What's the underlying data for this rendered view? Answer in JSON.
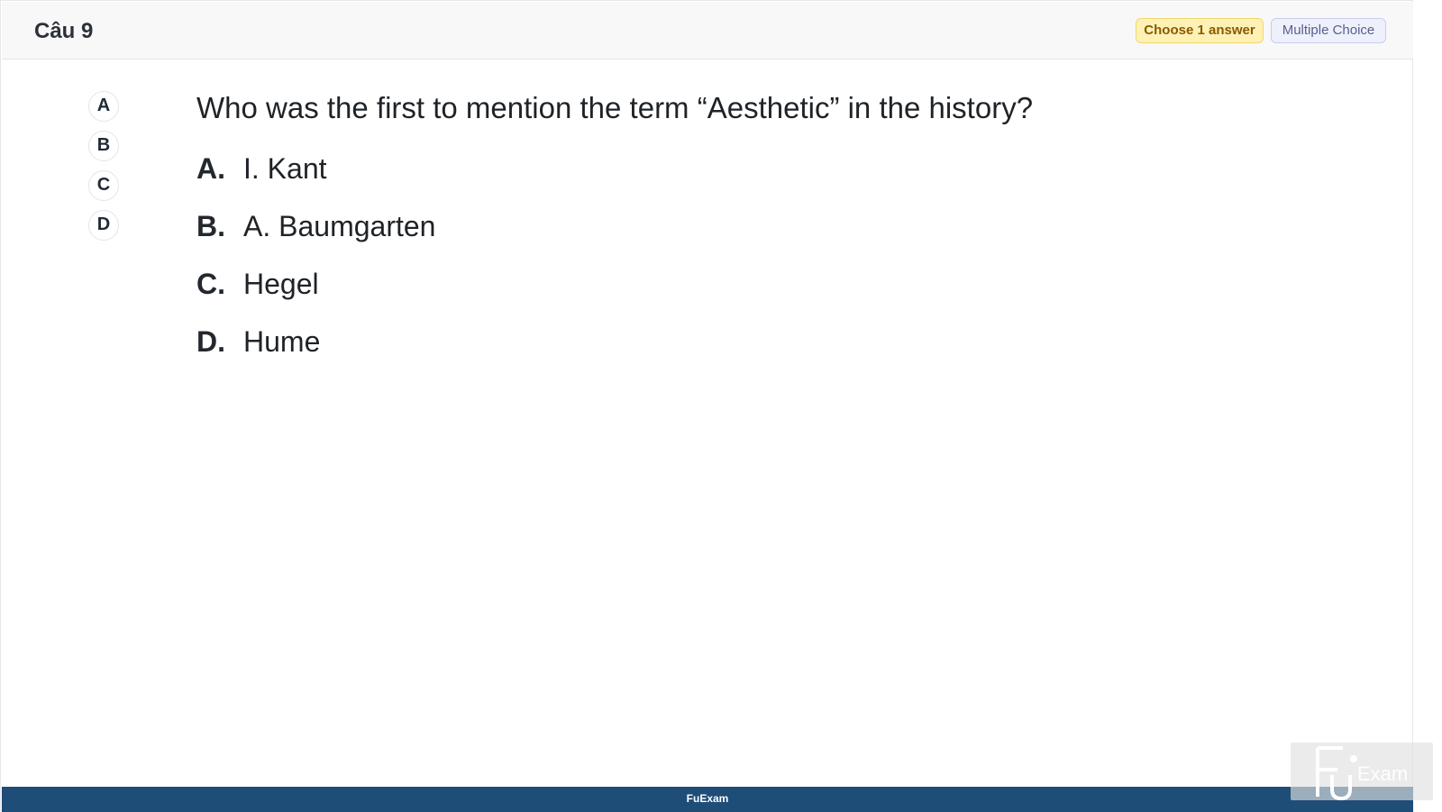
{
  "header": {
    "question_label": "Câu 9",
    "choose_badge": "Choose 1 answer",
    "type_badge": "Multiple Choice"
  },
  "sidebar": {
    "options": [
      "A",
      "B",
      "C",
      "D"
    ]
  },
  "question": {
    "text": "Who was the first to mention the term “Aesthetic” in the history?",
    "answers": [
      {
        "letter": "A.",
        "text": "I. Kant"
      },
      {
        "letter": "B.",
        "text": "A. Baumgarten"
      },
      {
        "letter": "C.",
        "text": "Hegel"
      },
      {
        "letter": "D.",
        "text": "Hume"
      }
    ]
  },
  "footer": {
    "brand": "FuExam"
  },
  "watermark": {
    "text": "Exam"
  },
  "colors": {
    "footer_bg": "#1e4d78",
    "choose_badge_bg": "#fdf1b5",
    "type_badge_bg": "#eef0fb"
  }
}
